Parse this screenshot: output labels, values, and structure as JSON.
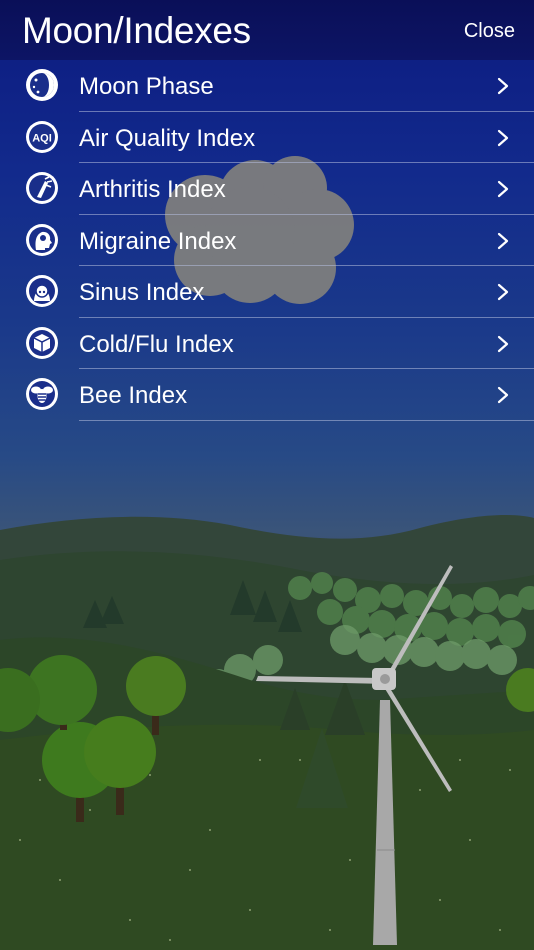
{
  "header": {
    "title": "Moon/Indexes",
    "close_label": "Close"
  },
  "menu": {
    "items": [
      {
        "label": "Moon Phase",
        "icon": "moon-phase-icon"
      },
      {
        "label": "Air Quality Index",
        "icon": "aqi-icon",
        "icon_text": "AQI"
      },
      {
        "label": "Arthritis Index",
        "icon": "arthritis-icon"
      },
      {
        "label": "Migraine Index",
        "icon": "migraine-icon"
      },
      {
        "label": "Sinus Index",
        "icon": "sinus-icon"
      },
      {
        "label": "Cold/Flu Index",
        "icon": "cold-flu-icon"
      },
      {
        "label": "Bee Index",
        "icon": "bee-icon"
      }
    ]
  },
  "colors": {
    "header_bg": "#0a0f58",
    "sky_top": "#0c1a80",
    "grass": "#2f4a22"
  }
}
